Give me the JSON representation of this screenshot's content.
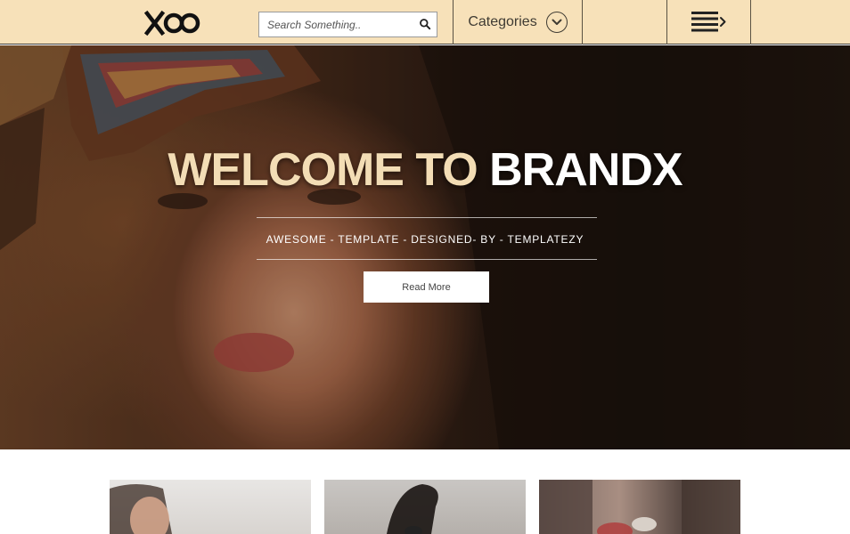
{
  "header": {
    "logo_text": "XOO",
    "search": {
      "placeholder": "Search Something..",
      "value": ""
    },
    "categories_label": "Categories",
    "menu_icon": "menu-arrow-icon"
  },
  "hero": {
    "title_part1": "WELCOME TO",
    "title_part2": "BRANDX",
    "subtitle": "AWESOME - TEMPLATE - DESIGNED- BY - TEMPLATEZY",
    "button_label": "Read More"
  },
  "cards": [
    {
      "image": "woman-portrait-photo"
    },
    {
      "image": "fashion-model-photo"
    },
    {
      "image": "city-street-photo"
    }
  ],
  "colors": {
    "header_bg": "#f7e1b9",
    "title_accent": "#f3ddb5",
    "title_white": "#ffffff",
    "button_bg": "#ffffff"
  }
}
